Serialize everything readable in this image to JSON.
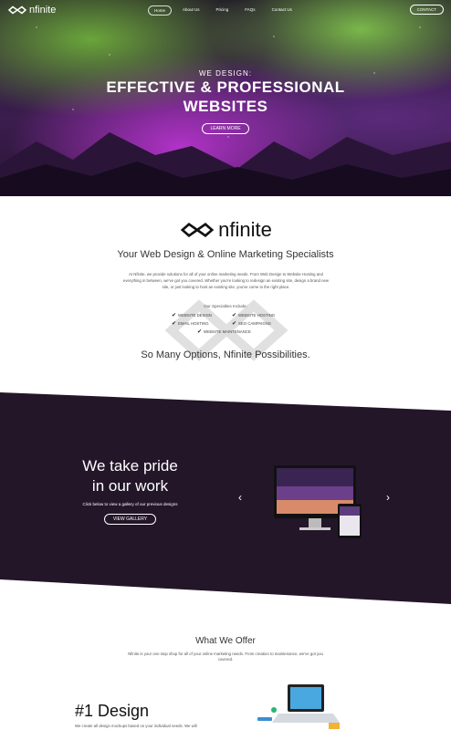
{
  "nav": {
    "brand": "nfinite",
    "items": [
      {
        "label": "Home",
        "active": true
      },
      {
        "label": "About Us",
        "active": false
      },
      {
        "label": "Pricing",
        "active": false
      },
      {
        "label": "FAQs",
        "active": false
      },
      {
        "label": "Contact Us",
        "active": false
      }
    ],
    "contact_button": "CONTACT"
  },
  "hero": {
    "kicker": "WE DESIGN:",
    "headline_1": "EFFECTIVE & PROFESSIONAL",
    "headline_2": "WEBSITES",
    "cta": "LEARN MORE"
  },
  "intro": {
    "logo_text": "nfinite",
    "tagline": "Your Web Design & Online Marketing Specialists",
    "paragraph": "At Nfinite, we provide solutions for all of your online marketing needs. From Web Design to Website Hosting and everything in between, we've got you covered. Whether you're looking to redesign an existing site, design a brand new site, or just looking to host an existing site, you've come to the right place.",
    "specialties_title": "Our Specialties Include:",
    "specialties": [
      "WEBSITE DESIGN",
      "WEBSITE HOSTING",
      "EMAIL HOSTING",
      "SEO CAMPAIGNS",
      "WEBSITE MAINTENANCE"
    ],
    "closing": "So Many Options, Nfinite Possibilities."
  },
  "gallery": {
    "heading_1": "We take pride",
    "heading_2": "in our work",
    "subtext": "Click below to view a gallery of our previous designs",
    "button": "VIEW GALLERY"
  },
  "offer": {
    "title": "What We Offer",
    "paragraph": "Nfinite is your one stop shop for all of your online marketing needs. From creation to maintenance, we've got you covered.",
    "feature_title": "#1 Design",
    "feature_text": "We create all design mockups based on your individual needs. We will"
  },
  "colors": {
    "dark_band": "#231629",
    "hero_purple": "#b133c8",
    "aurora_green": "#6aa53a"
  }
}
